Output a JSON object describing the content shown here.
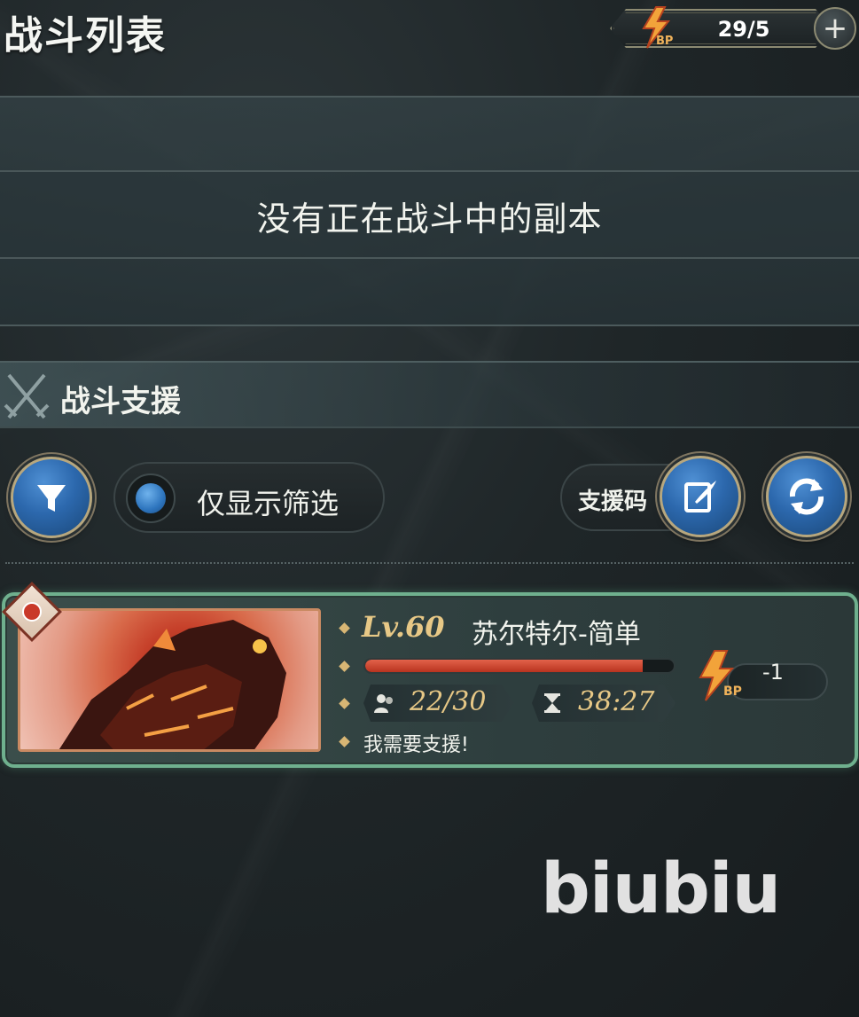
{
  "header": {
    "title": "战斗列表",
    "bp": {
      "value": "29/5",
      "unit": "BP",
      "add_icon": "plus-icon"
    }
  },
  "battle_list": {
    "empty_message": "没有正在战斗中的副本"
  },
  "support_section": {
    "title": "战斗支援",
    "icon": "crossed-swords-icon"
  },
  "toolbar": {
    "filter_icon": "funnel-icon",
    "filter_toggle_label": "仅显示筛选",
    "support_code_label": "支援码",
    "support_code_icon": "quill-paper-icon",
    "refresh_icon": "refresh-icon"
  },
  "support_list": [
    {
      "level": "Lv.60",
      "boss_name": "苏尔特尔-简单",
      "element_icon": "fire-element-icon",
      "hp_fraction": 0.9,
      "players": "22/30",
      "players_icon": "players-icon",
      "time_left": "38:27",
      "timer_icon": "hourglass-icon",
      "message": "我需要支援!",
      "bp_cost": "-1",
      "bp_unit": "BP"
    }
  ],
  "watermark": "biubiu",
  "colors": {
    "accent_blue": "#2c68ad",
    "card_border": "#6fb08e",
    "gold_text": "#e7c886",
    "hp_red": "#c8412a",
    "bp_orange": "#f0b25a"
  }
}
